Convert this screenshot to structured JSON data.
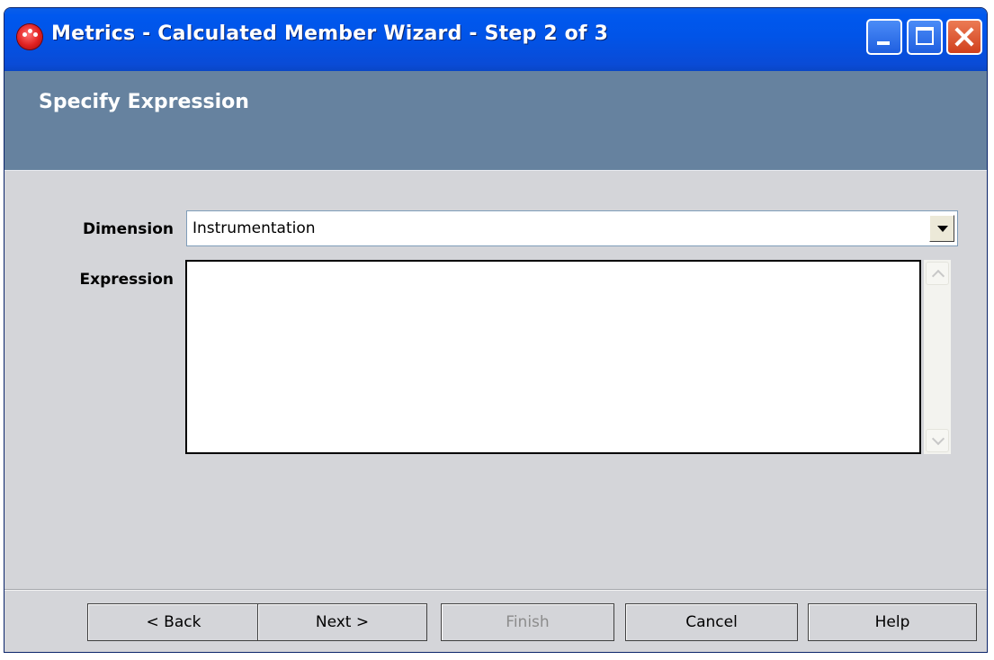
{
  "window": {
    "title": "Metrics - Calculated Member Wizard - Step 2 of 3",
    "icon": "metrics-app-icon",
    "controls": [
      "minimize-icon",
      "maximize-icon",
      "close-icon"
    ]
  },
  "header": {
    "title": "Specify Expression"
  },
  "form": {
    "dimension": {
      "label": "Dimension",
      "value": "Instrumentation"
    },
    "expression": {
      "label": "Expression",
      "value": ""
    }
  },
  "buttons": {
    "back": "< Back",
    "next": "Next >",
    "finish": "Finish",
    "cancel": "Cancel",
    "help": "Help"
  },
  "colors": {
    "titlebar": "#0054e3",
    "header_band": "#66829f",
    "dialog_bg": "#d4d5d9"
  }
}
